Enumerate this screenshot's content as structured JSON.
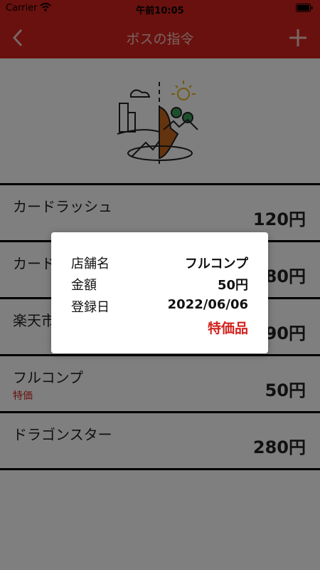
{
  "status_bar": {
    "carrier": "Carrier",
    "time": "午前10:05"
  },
  "nav": {
    "title": "ボスの指令",
    "back_icon": "chevron-left-icon",
    "add_icon": "plus-icon"
  },
  "items": [
    {
      "name": "カードラッシュ",
      "note": "",
      "price": "120円"
    },
    {
      "name": "カードラッシュ",
      "note": "",
      "price": "80円"
    },
    {
      "name": "楽天市場",
      "note": "",
      "price": "90円"
    },
    {
      "name": "フルコンプ",
      "note": "特価",
      "price": "50円"
    },
    {
      "name": "ドラゴンスター",
      "note": "",
      "price": "280円"
    }
  ],
  "dialog": {
    "shop_label": "店舗名",
    "shop_value": "フルコンプ",
    "amount_label": "金額",
    "amount_value": "50円",
    "date_label": "登録日",
    "date_value": "2022/06/06",
    "special": "特価品"
  },
  "colors": {
    "accent": "#d2221d"
  }
}
